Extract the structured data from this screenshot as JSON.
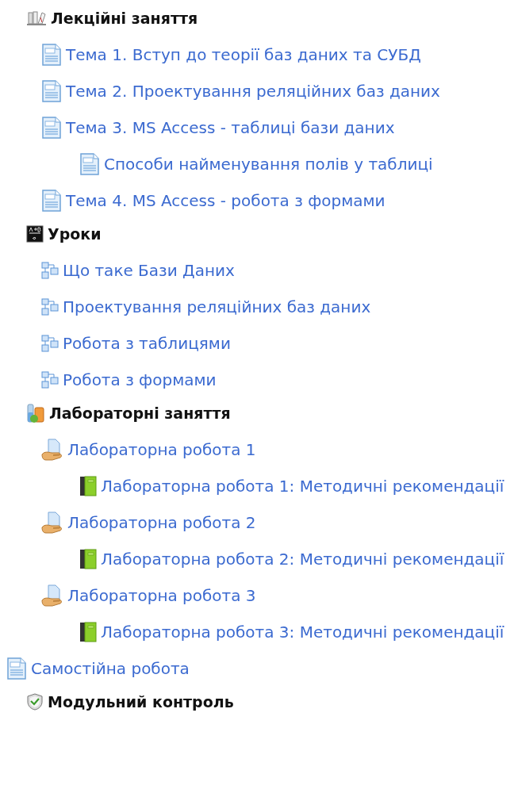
{
  "items": [
    {
      "kind": "lectures",
      "text": "Лекційні заняття",
      "children": [
        {
          "kind": "page",
          "text": "Тема 1. Вступ до теорії баз даних та СУБД"
        },
        {
          "kind": "page",
          "text": "Тема 2. Проектування реляційних баз даних"
        },
        {
          "kind": "page",
          "text": "Тема 3. MS Access - таблиці бази даних",
          "children": [
            {
              "kind": "page",
              "text": "Способи найменування полів у таблиці"
            }
          ]
        },
        {
          "kind": "page",
          "text": "Тема 4. MS Access - робота з формами"
        }
      ]
    },
    {
      "kind": "lessons",
      "text": "Уроки",
      "children": [
        {
          "kind": "lesson",
          "text": "Що таке Бази Даних"
        },
        {
          "kind": "lesson",
          "text": "Проектування реляційних баз даних"
        },
        {
          "kind": "lesson",
          "text": "Робота з таблицями"
        },
        {
          "kind": "lesson",
          "text": "Робота з формами"
        }
      ]
    },
    {
      "kind": "labs",
      "text": "Лабораторні заняття",
      "children": [
        {
          "kind": "assignment",
          "text": "Лабораторна робота 1",
          "children": [
            {
              "kind": "book",
              "text": "Лабораторна робота 1: Методичні рекомендації"
            }
          ]
        },
        {
          "kind": "assignment",
          "text": "Лабораторна робота 2",
          "children": [
            {
              "kind": "book",
              "text": "Лабораторна робота 2: Методичні рекомендації"
            }
          ]
        },
        {
          "kind": "assignment",
          "text": "Лабораторна робота 3",
          "children": [
            {
              "kind": "book",
              "text": "Лабораторна робота 3: Методичні рекомендації"
            }
          ]
        }
      ]
    },
    {
      "kind": "page",
      "text": "Самостійна робота"
    },
    {
      "kind": "quiz",
      "text": "Модульний контроль"
    }
  ]
}
